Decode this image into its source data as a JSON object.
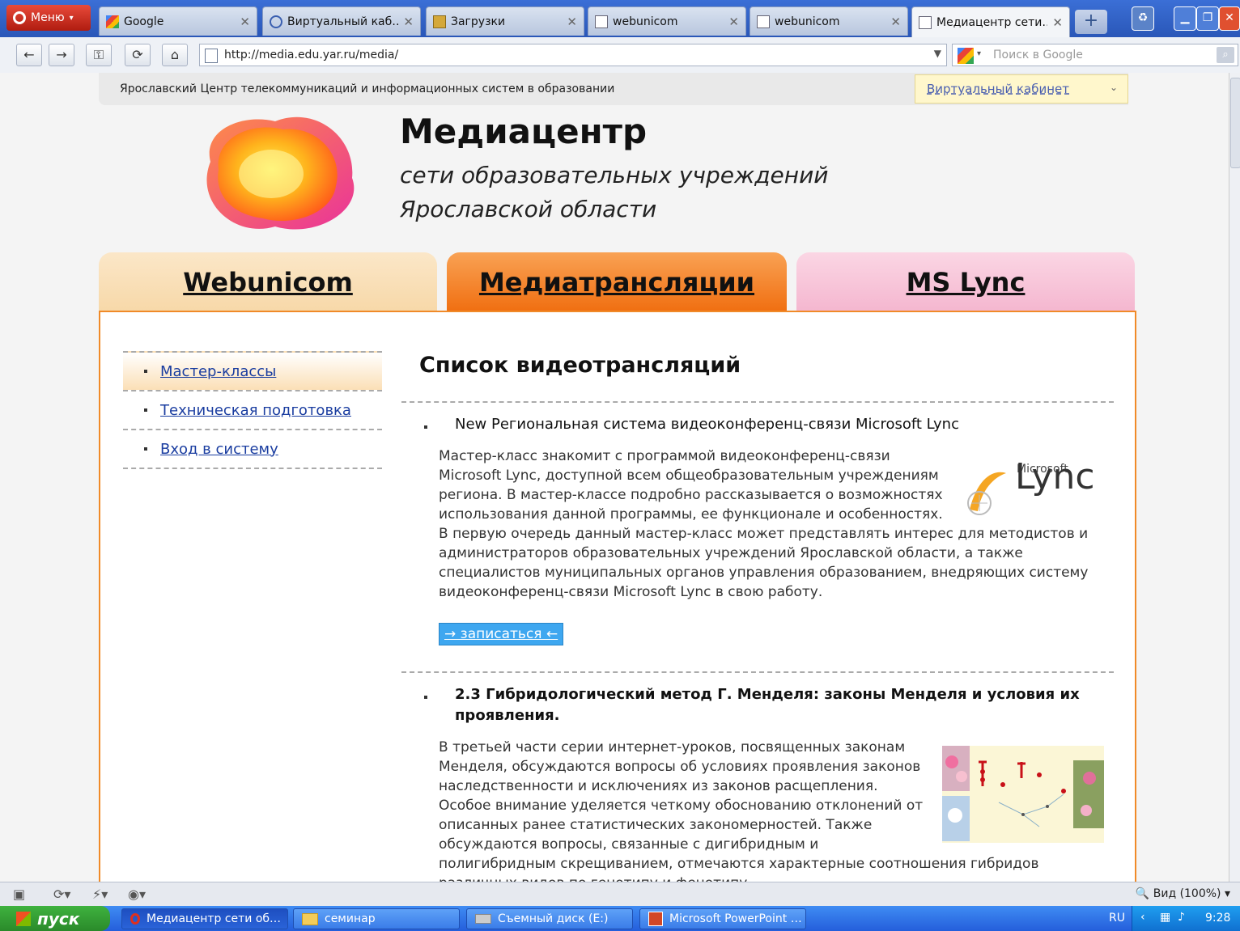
{
  "browser": {
    "menu_label": "Меню",
    "tabs": [
      {
        "label": "Google"
      },
      {
        "label": "Виртуальный каб…"
      },
      {
        "label": "Загрузки"
      },
      {
        "label": "webunicom"
      },
      {
        "label": "webunicom"
      },
      {
        "label": "Медиацентр сети…"
      }
    ],
    "url": "http://media.edu.yar.ru/media/",
    "search_placeholder": "Поиск в Google"
  },
  "header": {
    "org_name": "Ярославский Центр телекоммуникаций и информационных систем в образовании",
    "virtual_cabinet": "Виртуальный кабинет",
    "title": "Медиацентр",
    "subtitle_line1": "сети образовательных учреждений",
    "subtitle_line2": "Ярославской области"
  },
  "main_tabs": [
    {
      "label": "Webunicom"
    },
    {
      "label": "Медиатрансляции"
    },
    {
      "label": "MS Lync"
    }
  ],
  "sidebar": {
    "items": [
      {
        "label": "Мастер-классы"
      },
      {
        "label": "Техническая подготовка"
      },
      {
        "label": "Вход в систему"
      }
    ]
  },
  "content": {
    "title": "Список видеотрансляций",
    "items": [
      {
        "title": "New Региональная система видеоконференц-связи Microsoft Lync",
        "description": "Мастер-класс знакомит с программой видеоконференц-связи Microsoft Lync, доступной всем общеобразовательным учреждениям региона. В мастер-классе подробно рассказывается о возможностях использования данной программы, ее функционале и особенностях. В первую очередь данный мастер-класс может представлять интерес для методистов и администраторов образовательных учреждений Ярославской области, а также специалистов муниципальных органов управления образованием, внедряющих систему видеоконференц-связи Microsoft Lync в свою работу.",
        "logo_small": "Microsoft",
        "logo_big": "Lync",
        "signup": "→ записаться ←"
      },
      {
        "title": "2.3 Гибридологический метод Г. Менделя: законы Менделя и условия их проявления.",
        "description": "В третьей части серии интернет-уроков, посвященных законам Менделя, обсуждаются вопросы об условиях проявления законов наследственности и исключениях из законов расщепления. Особое внимание уделяется четкому обоснованию отклонений от описанных ранее статистических закономерностей. Также обсуждаются вопросы, связанные с дигибридным и полигибридным скрещиванием, отмечаются характерные соотношения гибридов различных видов по генотипу и фенотипу."
      }
    ]
  },
  "statusbar": {
    "zoom": "Вид (100%)"
  },
  "taskbar": {
    "start": "пуск",
    "buttons": [
      {
        "label": "Медиацентр сети об…"
      },
      {
        "label": "семинар"
      },
      {
        "label": "Съемный диск (E:)"
      },
      {
        "label": "Microsoft PowerPoint …"
      }
    ],
    "lang": "RU",
    "time": "9:28"
  }
}
